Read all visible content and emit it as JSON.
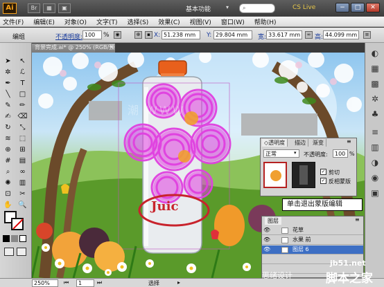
{
  "titlebar": {
    "app_logo": "Ai",
    "workspace": "基本功能",
    "cs_live": "CS Live",
    "minimize": "−",
    "restore": "□",
    "close": "✕"
  },
  "menubar": [
    "文件(F)",
    "编辑(E)",
    "对象(O)",
    "文字(T)",
    "选择(S)",
    "效果(C)",
    "视图(V)",
    "窗口(W)",
    "帮助(H)"
  ],
  "controlbar": {
    "group_label": "编组",
    "opacity_label": "不透明度:",
    "opacity_value": "100",
    "opacity_unit": "%",
    "x_label": "X:",
    "x_value": "51.238 mm",
    "y_label": "Y:",
    "y_value": "29.804 mm",
    "w_label": "宽:",
    "w_value": "33.617 mm",
    "h_label": "高:",
    "h_value": "44.099 mm"
  },
  "document_tab": {
    "title": "背景完成.ai* @ 250% (RGB/预览)",
    "close": "×"
  },
  "canvas": {
    "juice_text": "Juic"
  },
  "transparency_panel": {
    "tabs": [
      "◇透明度",
      "描边",
      "渐变"
    ],
    "blend_mode": "正常",
    "opacity_label": "不透明度:",
    "opacity_value": "100",
    "opacity_unit": "%",
    "clip_label": "剪切",
    "invert_label": "反相蒙版"
  },
  "tooltip": {
    "text": "单击退出蒙版编辑"
  },
  "layers_panel": {
    "title": "图层",
    "layers": [
      {
        "name": "花草"
      },
      {
        "name": "水果 前"
      },
      {
        "name": "图层 6"
      }
    ]
  },
  "statusbar": {
    "zoom": "250%",
    "page": "1",
    "mode": "选择"
  },
  "watermark": {
    "site": "jb51.net",
    "brand": "脚本之家",
    "partial": "思绪设计"
  },
  "colors": {
    "magenta_selection": "#e040e0",
    "accent_orange": "#f7a21b",
    "bottle_cap": "#e8601c",
    "juice_red": "#c8232c"
  }
}
